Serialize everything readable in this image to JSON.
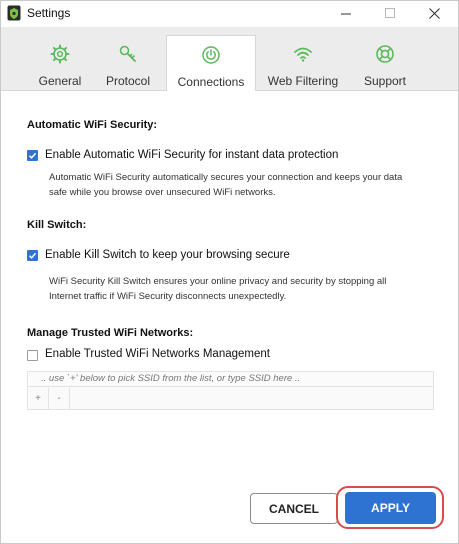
{
  "window": {
    "title": "Settings",
    "controls": {
      "minimize": "minimize",
      "maximize": "maximize",
      "close": "close"
    }
  },
  "tabs": [
    {
      "label": "General",
      "icon": "gear-icon",
      "active": false
    },
    {
      "label": "Protocol",
      "icon": "key-icon",
      "active": false
    },
    {
      "label": "Connections",
      "icon": "power-icon",
      "active": true
    },
    {
      "label": "Web Filtering",
      "icon": "wifi-icon",
      "active": false
    },
    {
      "label": "Support",
      "icon": "lifebuoy-icon",
      "active": false
    }
  ],
  "colors": {
    "accent": "#2f73d2",
    "tab_icon": "#5cb85c",
    "highlight_ring": "#d94b4b"
  },
  "sections": {
    "auto_wifi": {
      "title": "Automatic WiFi Security:",
      "checkbox_label": "Enable Automatic WiFi Security for instant data protection",
      "checked": true,
      "description": "Automatic WiFi Security automatically secures your connection and keeps your data safe while you browse over unsecured WiFi networks."
    },
    "kill_switch": {
      "title": "Kill Switch:",
      "checkbox_label": "Enable Kill Switch to keep your browsing secure",
      "checked": true,
      "description": "WiFi Security Kill Switch ensures your online privacy and security by stopping all Internet traffic if WiFi Security disconnects unexpectedly."
    },
    "trusted": {
      "title": "Manage Trusted WiFi Networks:",
      "checkbox_label": "Enable Trusted WiFi Networks Management",
      "checked": false,
      "ssid_placeholder": ".. use `+' below to pick SSID from the list, or type SSID here ..",
      "add_label": "+",
      "remove_label": "-"
    }
  },
  "footer": {
    "cancel_label": "CANCEL",
    "apply_label": "APPLY"
  }
}
